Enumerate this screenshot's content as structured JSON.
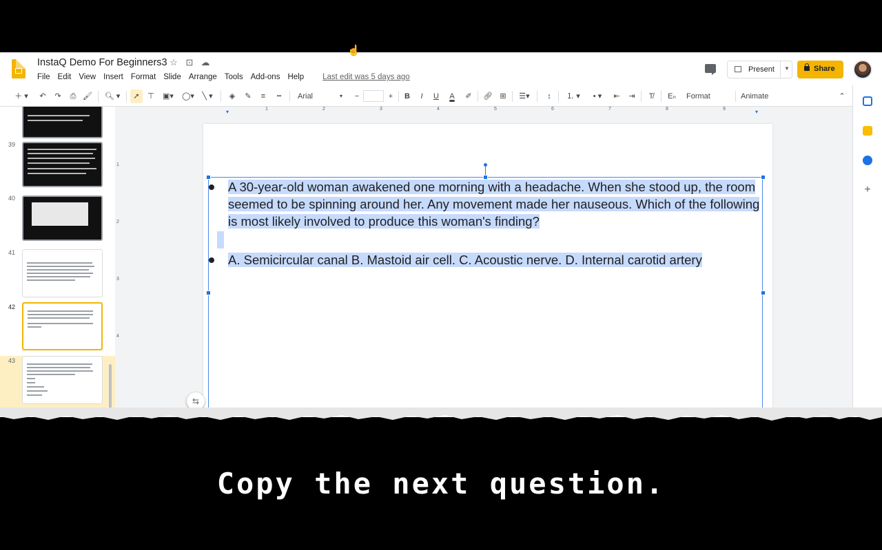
{
  "app": {
    "title": "InstaQ Demo For Beginners3",
    "menu": [
      "File",
      "Edit",
      "View",
      "Insert",
      "Format",
      "Slide",
      "Arrange",
      "Tools",
      "Add-ons",
      "Help"
    ],
    "last_edit": "Last edit was 5 days ago",
    "present_label": "Present",
    "share_label": "Share",
    "brand_color": "#f4b400"
  },
  "toolbar": {
    "font_name": "Arial",
    "font_size": "",
    "format_options": "Format options",
    "animate": "Animate"
  },
  "ruler": {
    "h_ticks": [
      "1",
      "2",
      "3",
      "4",
      "5",
      "6",
      "7",
      "8",
      "9"
    ],
    "v_ticks": [
      "1",
      "2",
      "3",
      "4"
    ]
  },
  "filmstrip": {
    "slides": [
      "39",
      "40",
      "41",
      "42",
      "43"
    ],
    "selected": "42"
  },
  "slide": {
    "question": "A 30-year-old woman awakened one morning with a headache. When she stood up, the room seemed to be spinning around her. Any movement made her nauseous. Which of the following is most likely involved to produce this woman's finding?",
    "options": "A.  Semicircular canal   B.  Mastoid air cell.  C.  Acoustic nerve.  D.  Internal carotid artery"
  },
  "caption": "Copy the next question."
}
